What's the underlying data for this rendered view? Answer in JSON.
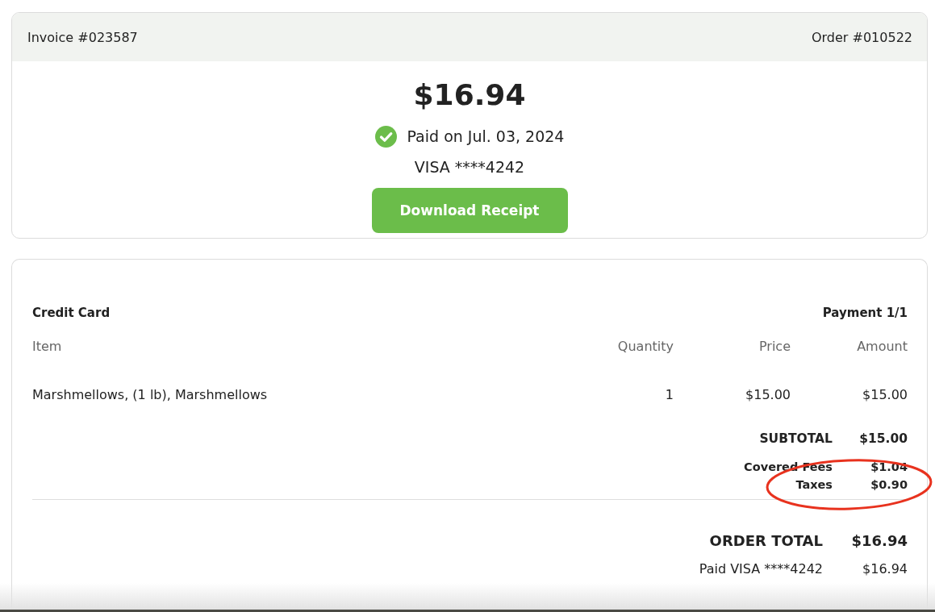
{
  "invoice": {
    "invoice_number": "Invoice #023587",
    "order_number": "Order #010522",
    "amount": "$16.94",
    "paid_text": "Paid on Jul. 03, 2024",
    "card": "VISA ****4242",
    "button": "Download Receipt"
  },
  "payment": {
    "method": "Credit Card",
    "counter": "Payment 1/1",
    "table": {
      "columns": [
        "Item",
        "Quantity",
        "Price",
        "Amount"
      ],
      "rows": [
        {
          "item": "Marshmellows, (1 lb), Marshmellows",
          "quantity": "1",
          "price": "$15.00",
          "amount": "$15.00"
        }
      ]
    },
    "summary": [
      {
        "kind": "subtotal",
        "label": "SUBTOTAL",
        "value": "$15.00",
        "highlighted": false
      },
      {
        "kind": "fee",
        "label": "Covered Fees",
        "value": "$1.04",
        "highlighted": false
      },
      {
        "kind": "fee",
        "label": "Taxes",
        "value": "$0.90",
        "highlighted": true
      }
    ],
    "totals": [
      {
        "kind": "total",
        "label": "ORDER TOTAL",
        "value": "$16.94"
      },
      {
        "kind": "paid",
        "label": "Paid VISA ****4242",
        "value": "$16.94"
      }
    ]
  }
}
